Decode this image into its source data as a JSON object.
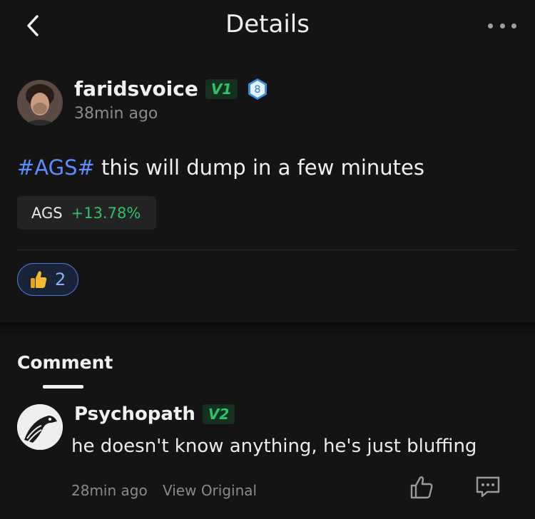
{
  "header": {
    "title": "Details",
    "back_icon": "chevron-left-icon",
    "more_icon": "more-horizontal-icon"
  },
  "post": {
    "author": "faridsvoice",
    "vip_badge": "V1",
    "level_badge": "8",
    "time": "38min ago",
    "hashtag": "#AGS#",
    "text": " this will dump in a few minutes",
    "stock": {
      "symbol": "AGS",
      "change": "+13.78%"
    },
    "likes": {
      "icon": "thumbs-up-emoji-icon",
      "count": "2"
    }
  },
  "comments": {
    "heading": "Comment",
    "items": [
      {
        "author": "Psychopath",
        "vip_badge": "V2",
        "text": "he doesn't know anything, he's just bluffing",
        "time": "28min ago",
        "view_original": "View Original"
      }
    ]
  },
  "colors": {
    "background": "#141414",
    "accent_blue": "#5b8dff",
    "positive_green": "#2ec26a",
    "muted_text": "#8a8a8a"
  }
}
